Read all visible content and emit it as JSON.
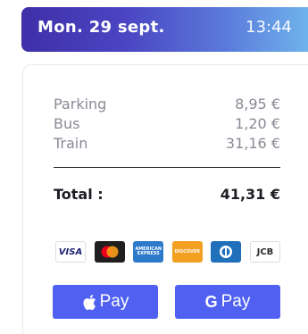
{
  "header": {
    "date": "Mon. 29 sept.",
    "time": "13:44"
  },
  "items": [
    {
      "label": "Parking",
      "amount": "8,95 €"
    },
    {
      "label": "Bus",
      "amount": "1,20 €"
    },
    {
      "label": "Train",
      "amount": "31,16 €"
    }
  ],
  "total": {
    "label": "Total :",
    "amount": "41,31 €"
  },
  "card_brands": [
    {
      "name": "visa-logo",
      "text": "VISA"
    },
    {
      "name": "mastercard-logo",
      "text": ""
    },
    {
      "name": "amex-logo",
      "text": "AMERICAN EXPRESS"
    },
    {
      "name": "discover-logo",
      "text": "DISCOVER"
    },
    {
      "name": "diners-logo",
      "text": ""
    },
    {
      "name": "jcb-logo",
      "text": "JCB"
    }
  ],
  "payment_buttons": {
    "apple_pay_label": "Pay",
    "google_pay_glyph": "G",
    "google_pay_label": "Pay"
  },
  "colors": {
    "header_gradient_start": "#3f2fa8",
    "header_gradient_end": "#6fb3ec",
    "pay_button": "#5061f2"
  }
}
